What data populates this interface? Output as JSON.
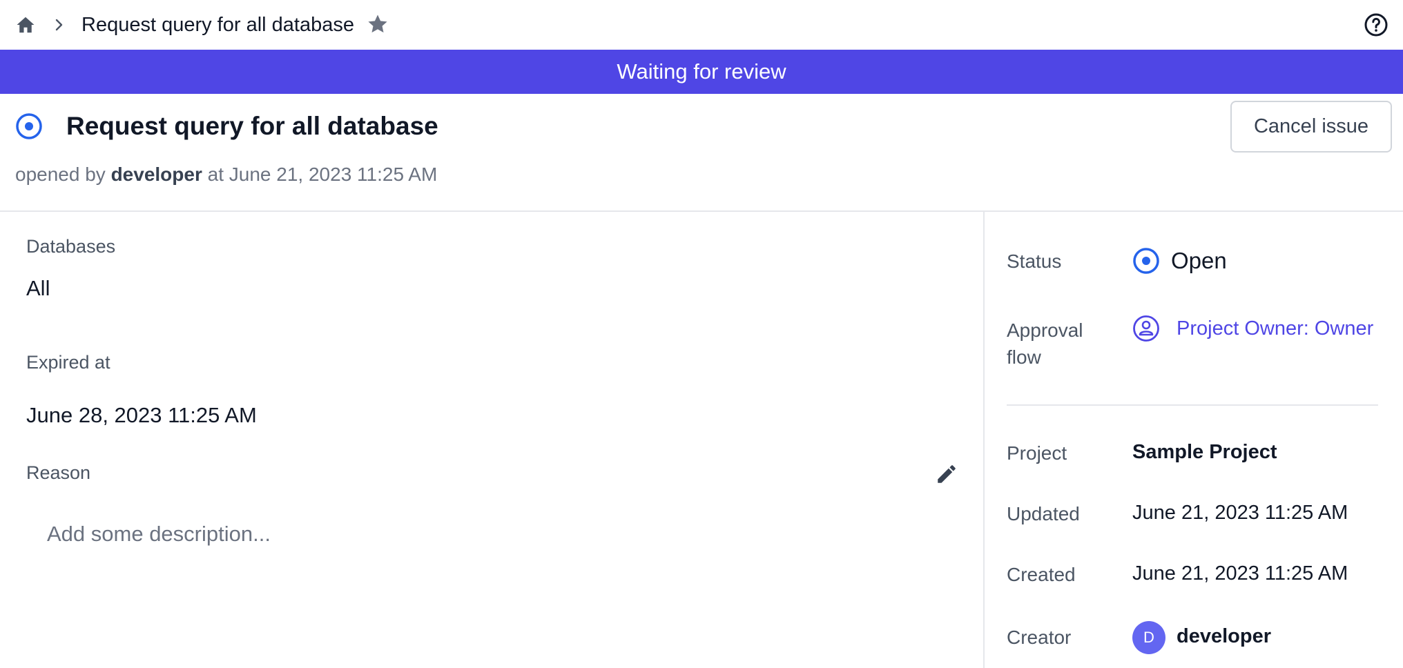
{
  "breadcrumb": {
    "home_icon": "home-icon",
    "separator_icon": "chevron-right-icon",
    "title": "Request query for all database",
    "star_icon": "star-icon"
  },
  "help_icon": "question-circle-icon",
  "banner": {
    "text": "Waiting for review",
    "color": "#4f46e5"
  },
  "issue": {
    "title": "Request query for all database",
    "opened_prefix": "opened by",
    "author": "developer",
    "opened_at": "at June 21, 2023 11:25 AM",
    "cancel_label": "Cancel issue"
  },
  "main": {
    "databases_label": "Databases",
    "databases_value": "All",
    "expired_label": "Expired at",
    "expired_value": "June 28, 2023 11:25 AM",
    "reason_label": "Reason",
    "reason_placeholder": "Add some description..."
  },
  "sidebar": {
    "status_label": "Status",
    "status_value": "Open",
    "approval_label": "Approval flow",
    "approval_value": "Project Owner:  Owner",
    "project_label": "Project",
    "project_value": "Sample Project",
    "updated_label": "Updated",
    "updated_value": "June 21, 2023 11:25 AM",
    "created_label": "Created",
    "created_value": "June 21, 2023 11:25 AM",
    "creator_label": "Creator",
    "creator_initial": "D",
    "creator_name": "developer"
  },
  "colors": {
    "accent": "#4f46e5",
    "status_blue": "#2563eb",
    "avatar": "#6366f1"
  }
}
